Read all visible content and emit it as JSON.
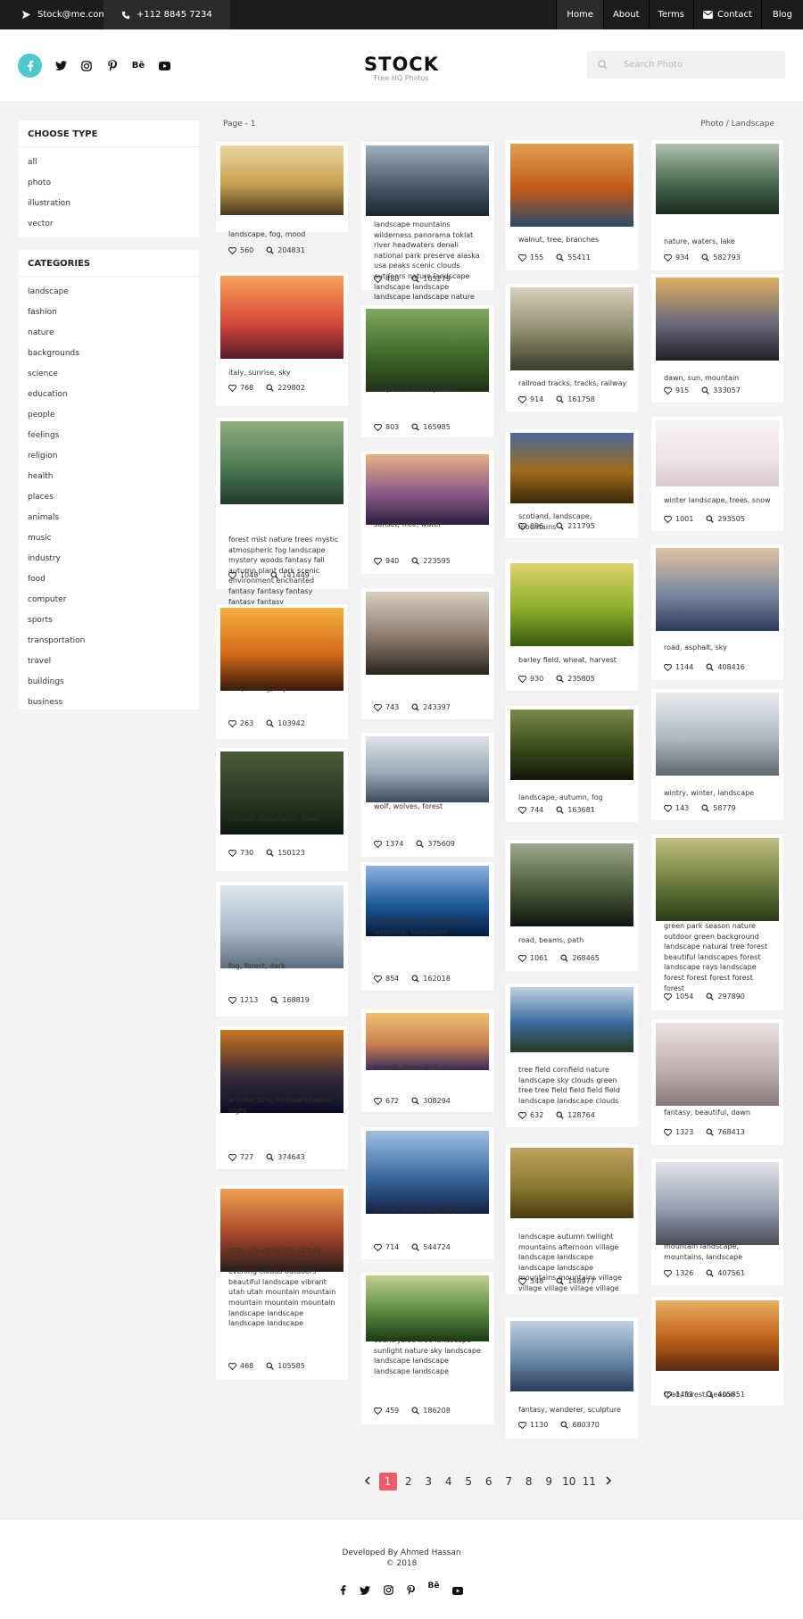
{
  "topbar": {
    "email": "Stock@me.com",
    "phone": "+112 8845 7234",
    "nav": [
      {
        "label": "Home",
        "icon": ""
      },
      {
        "label": "About",
        "icon": ""
      },
      {
        "label": "Terms",
        "icon": ""
      },
      {
        "label": "Contact",
        "icon": "mail-icon"
      },
      {
        "label": "Blog",
        "icon": ""
      }
    ]
  },
  "header": {
    "logo": "STOCK",
    "tagline": "Free HQ Photos",
    "search_placeholder": "Search Photo",
    "social": [
      "facebook-icon",
      "twitter-icon",
      "instagram-icon",
      "pinterest-icon",
      "behance-icon",
      "youtube-icon"
    ],
    "accent": "#4fc9cf"
  },
  "sidebar": {
    "type_title": "CHOOSE TYPE",
    "types": [
      "all",
      "photo",
      "illustration",
      "vector"
    ],
    "categories_title": "CATEGORIES",
    "categories": [
      "landscape",
      "fashion",
      "nature",
      "backgrounds",
      "science",
      "education",
      "people",
      "feelings",
      "religion",
      "health",
      "places",
      "animals",
      "music",
      "industry",
      "food",
      "computer",
      "sports",
      "transportation",
      "travel",
      "buildings",
      "business"
    ]
  },
  "gallery": {
    "page_label": "Page - 1",
    "breadcrumb": "Photo / Landscape",
    "columns": [
      [
        {
          "tags": "landscape, fog, mood",
          "likes": "560",
          "views": "204831"
        },
        {
          "tags": "italy, sunrise, sky",
          "likes": "768",
          "views": "229802"
        },
        {
          "tags": "forest mist nature trees mystic atmospheric fog landscape mystery woods fantasy fall autumn plant dark scenic environment enchanted fantasy fantasy fantasy fantasy fantasy",
          "likes": "1048",
          "views": "141449"
        },
        {
          "tags": "sun, setting, sky",
          "likes": "263",
          "views": "103942"
        },
        {
          "tags": "canyon, mountains, deep",
          "likes": "730",
          "views": "150123"
        },
        {
          "tags": "fog, forest, dark",
          "likes": "1213",
          "views": "168819"
        },
        {
          "tags": "architecture, fachwerkhauser, night",
          "likes": "727",
          "views": "374643"
        },
        {
          "tags": "utah mountain sky nature golden hour sunset scenic evening clouds outdoors beautiful landscape vibrant utah utah mountain mountain mountain mountain mountain landscape landscape landscape landscape",
          "likes": "468",
          "views": "105585"
        }
      ],
      [
        {
          "tags": "landscape mountains wilderness panorama toklat river headwaters denali national park preserve alaska usa peaks scenic clouds outdoors nature landscape landscape landscape landscape landscape nature",
          "likes": "480",
          "views": "105279"
        },
        {
          "tags": "mill, black forest, bach",
          "likes": "803",
          "views": "165985"
        },
        {
          "tags": "sunset, tree, water",
          "likes": "940",
          "views": "223595"
        },
        {
          "tags": "lone tree, tree, oak",
          "likes": "743",
          "views": "243397"
        },
        {
          "tags": "wolf, wolves, forest",
          "likes": "1374",
          "views": "375609"
        },
        {
          "tags": "yellowstone national park, wyoming, landscape",
          "likes": "854",
          "views": "162018"
        },
        {
          "tags": "sunset, dawn, nature",
          "likes": "672",
          "views": "308294"
        },
        {
          "tags": "nature, landscape, kaçkars",
          "likes": "714",
          "views": "544724"
        },
        {
          "tags": "countryside tree landscape sunlight nature sky landscape landscape landscape landscape landscape",
          "likes": "459",
          "views": "186208"
        }
      ],
      [
        {
          "tags": "walnut, tree, branches",
          "likes": "155",
          "views": "55411"
        },
        {
          "tags": "railroad tracks, tracks, railway",
          "likes": "914",
          "views": "161758"
        },
        {
          "tags": "scotland, landscape, mountains",
          "likes": "896",
          "views": "211795"
        },
        {
          "tags": "barley field, wheat, harvest",
          "likes": "930",
          "views": "235805"
        },
        {
          "tags": "landscape, autumn, fog",
          "likes": "744",
          "views": "163681"
        },
        {
          "tags": "road, beams, path",
          "likes": "1061",
          "views": "268465"
        },
        {
          "tags": "tree field cornfield nature landscape sky clouds green tree tree field field field field landscape landscape clouds",
          "likes": "632",
          "views": "128764"
        },
        {
          "tags": "landscape autumn twilight mountains afternoon village landscape landscape landscape landscape mountains mountains village village village village village",
          "likes": "548",
          "views": "148977"
        },
        {
          "tags": "fantasy, wanderer, sculpture",
          "likes": "1130",
          "views": "680370"
        }
      ],
      [
        {
          "tags": "nature, waters, lake",
          "likes": "934",
          "views": "582793"
        },
        {
          "tags": "dawn, sun, mountain",
          "likes": "915",
          "views": "333057"
        },
        {
          "tags": "winter landscape, trees, snow",
          "likes": "1001",
          "views": "293505"
        },
        {
          "tags": "road, asphalt, sky",
          "likes": "1144",
          "views": "408416"
        },
        {
          "tags": "wintry, winter, landscape",
          "likes": "143",
          "views": "58779"
        },
        {
          "tags": "green park season nature outdoor green background landscape natural tree forest beautiful landscapes forest landscape rays landscape forest forest forest forest forest",
          "likes": "1054",
          "views": "297890"
        },
        {
          "tags": "fantasy, beautiful, dawn",
          "likes": "1323",
          "views": "768413"
        },
        {
          "tags": "mountain landscape, mountains, landscape",
          "likes": "1326",
          "views": "407561"
        },
        {
          "tags": "road, forest, season",
          "likes": "1431",
          "views": "405851"
        }
      ]
    ]
  },
  "pagination": {
    "pages": [
      "1",
      "2",
      "3",
      "4",
      "5",
      "6",
      "7",
      "8",
      "9",
      "10",
      "11"
    ],
    "current": "1",
    "active_color": "#f45b69"
  },
  "footer": {
    "developer": "Developed By Ahmed Hassan",
    "copyright": "© 2018",
    "social": [
      "facebook-icon",
      "twitter-icon",
      "instagram-icon",
      "pinterest-icon",
      "behance-icon",
      "youtube-icon"
    ]
  }
}
